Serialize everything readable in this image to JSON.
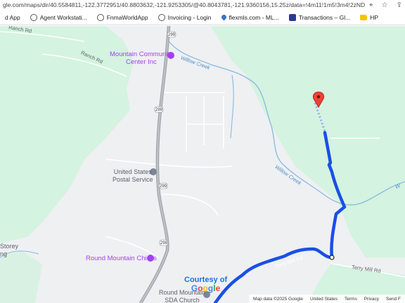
{
  "browser": {
    "url": "gle.com/maps/dir/40.5584811,-122.3772951/40.8803632,-121.9253305/@40.8043781,-121.9360156,15.25z/data=!4m11!1m5!3m4!2zNDDCsDQ4Jz..."
  },
  "bookmarks": [
    {
      "label": "d App",
      "icon": "app-icon"
    },
    {
      "label": "Agent Workstati...",
      "icon": "globe-icon"
    },
    {
      "label": "FnmaWorldApp",
      "icon": "globe-icon"
    },
    {
      "label": "Invoicing - Login",
      "icon": "globe-icon"
    },
    {
      "label": "flexmls.com - ML...",
      "icon": "pin-icon"
    },
    {
      "label": "Transactions – Gl...",
      "icon": "transactions-icon"
    },
    {
      "label": "HP",
      "icon": "folder-icon"
    }
  ],
  "map": {
    "places": {
      "community_center": "Mountain Community\nCenter Inc",
      "post_office": "United States\nPostal Service",
      "chicks": "Round Mountain Chicks",
      "church": "Round Mountain\nSDA Church",
      "storey": "Storey\nng"
    },
    "roads": {
      "ranch_rd_1": "Ranch Rd",
      "ranch_rd_2": "Ranch Rd",
      "terry_mill": "Terry Mill Rd",
      "terry_mill_route": "Terry Mill Rd",
      "shield_1": "299",
      "shield_2": "299",
      "shield_3": "299",
      "shield_4": "299",
      "shield_5": "299"
    },
    "creeks": {
      "willow_1": "Willow Creek",
      "willow_2": "Willow Creek",
      "willow_3": "W"
    },
    "overlay": {
      "courtesy": "Courtesy of",
      "google": [
        "G",
        "o",
        "o",
        "g",
        "l",
        "e"
      ]
    },
    "footer": {
      "data": "Map data ©2025 Google",
      "country": "United States",
      "terms": "Terms",
      "privacy": "Privacy",
      "send": "Send F"
    },
    "colors": {
      "route": "#1a4fe6",
      "forest": "#d4f3e0",
      "land": "#eef0f2",
      "water": "#8ab8e0",
      "pin": "#ea4335"
    }
  }
}
